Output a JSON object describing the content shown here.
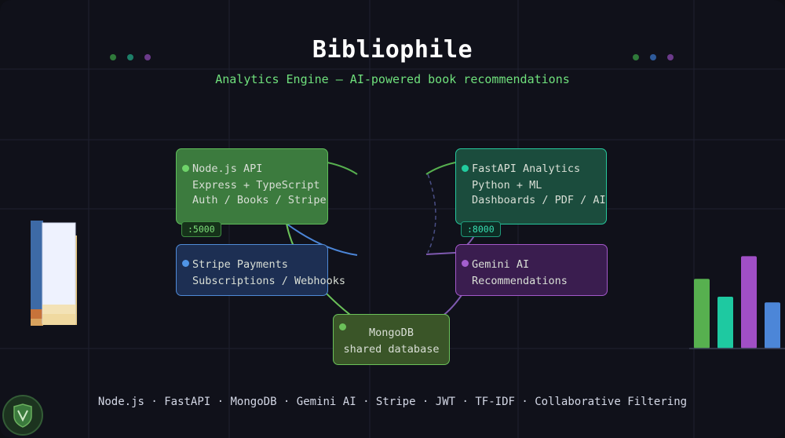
{
  "header": {
    "title": "Bibliophile",
    "subtitle": "Analytics Engine — AI-powered book recommendations"
  },
  "colors": {
    "green": "#57b04f",
    "teal": "#1ec9a1",
    "blue": "#4c86d8",
    "purple": "#a04fc6",
    "lime": "#6bc159"
  },
  "nodes": {
    "node_api": {
      "title": "Node.js API",
      "line1": "Express + TypeScript",
      "line2": "Auth / Books / Stripe",
      "port": ":5000"
    },
    "fastapi": {
      "title": "FastAPI Analytics",
      "line1": "Python + ML",
      "line2": "Dashboards / PDF / AI",
      "port": ":8000"
    },
    "stripe": {
      "title": "Stripe Payments",
      "line1": "Subscriptions / Webhooks"
    },
    "gemini": {
      "title": "Gemini AI",
      "line1": "Recommendations"
    },
    "mongodb": {
      "title": "MongoDB",
      "line1": "shared database"
    }
  },
  "footer": {
    "tech_stack": "Node.js · FastAPI · MongoDB · Gemini AI · Stripe · JWT · TF-IDF · Collaborative Filtering"
  },
  "decor": {
    "bar_chart_levels": [
      0.74,
      0.55,
      0.98,
      0.49
    ]
  }
}
